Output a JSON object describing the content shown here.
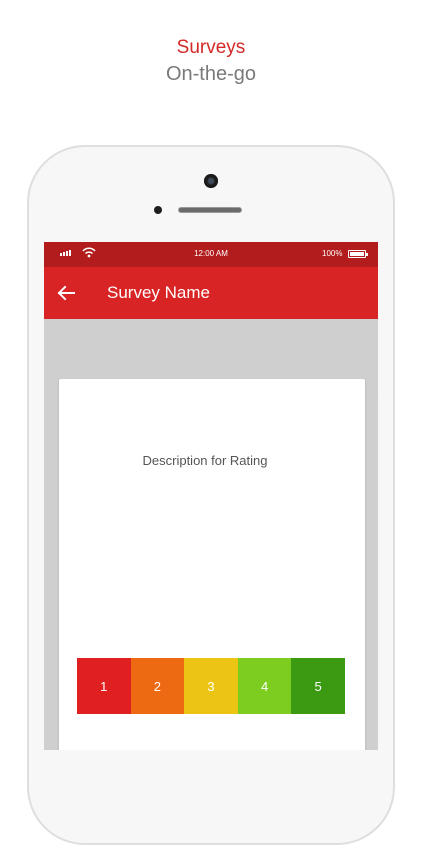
{
  "promo": {
    "title": "Surveys",
    "subtitle": "On-the-go"
  },
  "status_bar": {
    "time": "12:00  AM",
    "battery": "100%"
  },
  "app_bar": {
    "title": "Survey Name",
    "back_icon": "arrow-left-icon"
  },
  "card": {
    "description": "Description for Rating"
  },
  "rating": {
    "options": [
      {
        "label": "1",
        "color": "#e02020"
      },
      {
        "label": "2",
        "color": "#ee6a12"
      },
      {
        "label": "3",
        "color": "#ecc414"
      },
      {
        "label": "4",
        "color": "#7ccd1f"
      },
      {
        "label": "5",
        "color": "#3b9a12"
      }
    ]
  },
  "colors": {
    "brand_red": "#d82424",
    "status_red": "#b21c1c",
    "promo_red": "#d42a27"
  }
}
